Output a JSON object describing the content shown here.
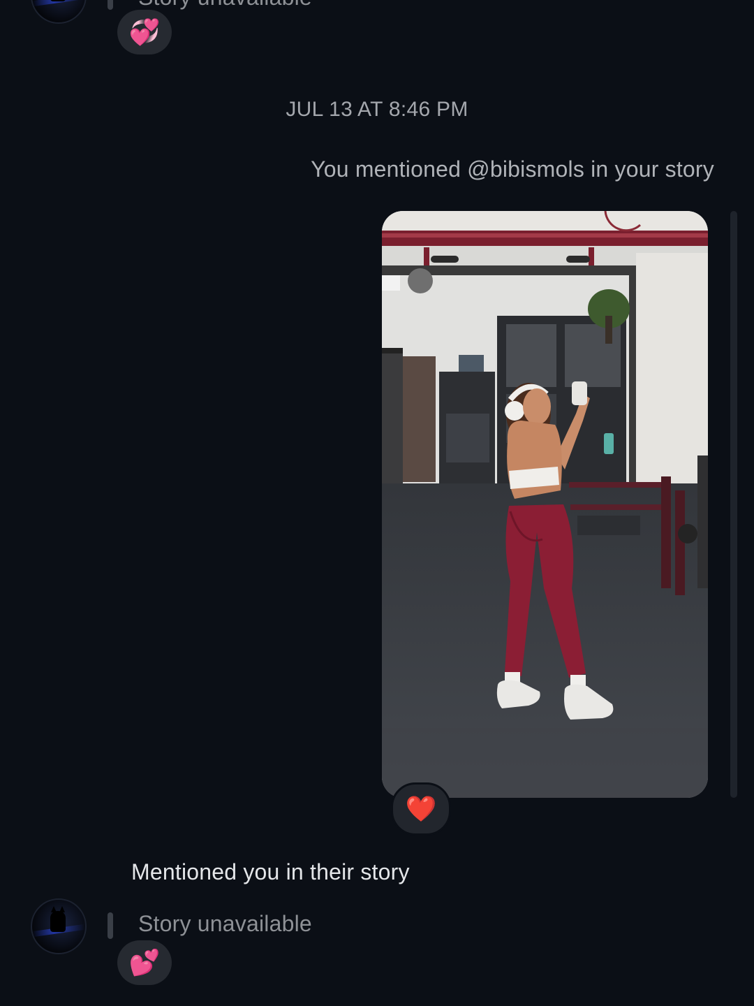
{
  "top_thread": {
    "story_label": "Story unavailable",
    "reaction_emoji": "💞"
  },
  "timestamp": "JUL 13 AT 8:46 PM",
  "outgoing_mention": "You mentioned @bibismols in your story",
  "story_card": {
    "reaction_emoji": "❤️"
  },
  "incoming_mention": {
    "label": "Mentioned you in their story",
    "story_label": "Story unavailable",
    "reaction_emoji": "💕"
  },
  "colors": {
    "background": "#0b0f16",
    "pill": "#262a31",
    "muted_text": "#8e9196",
    "heart": "#ff3040"
  }
}
